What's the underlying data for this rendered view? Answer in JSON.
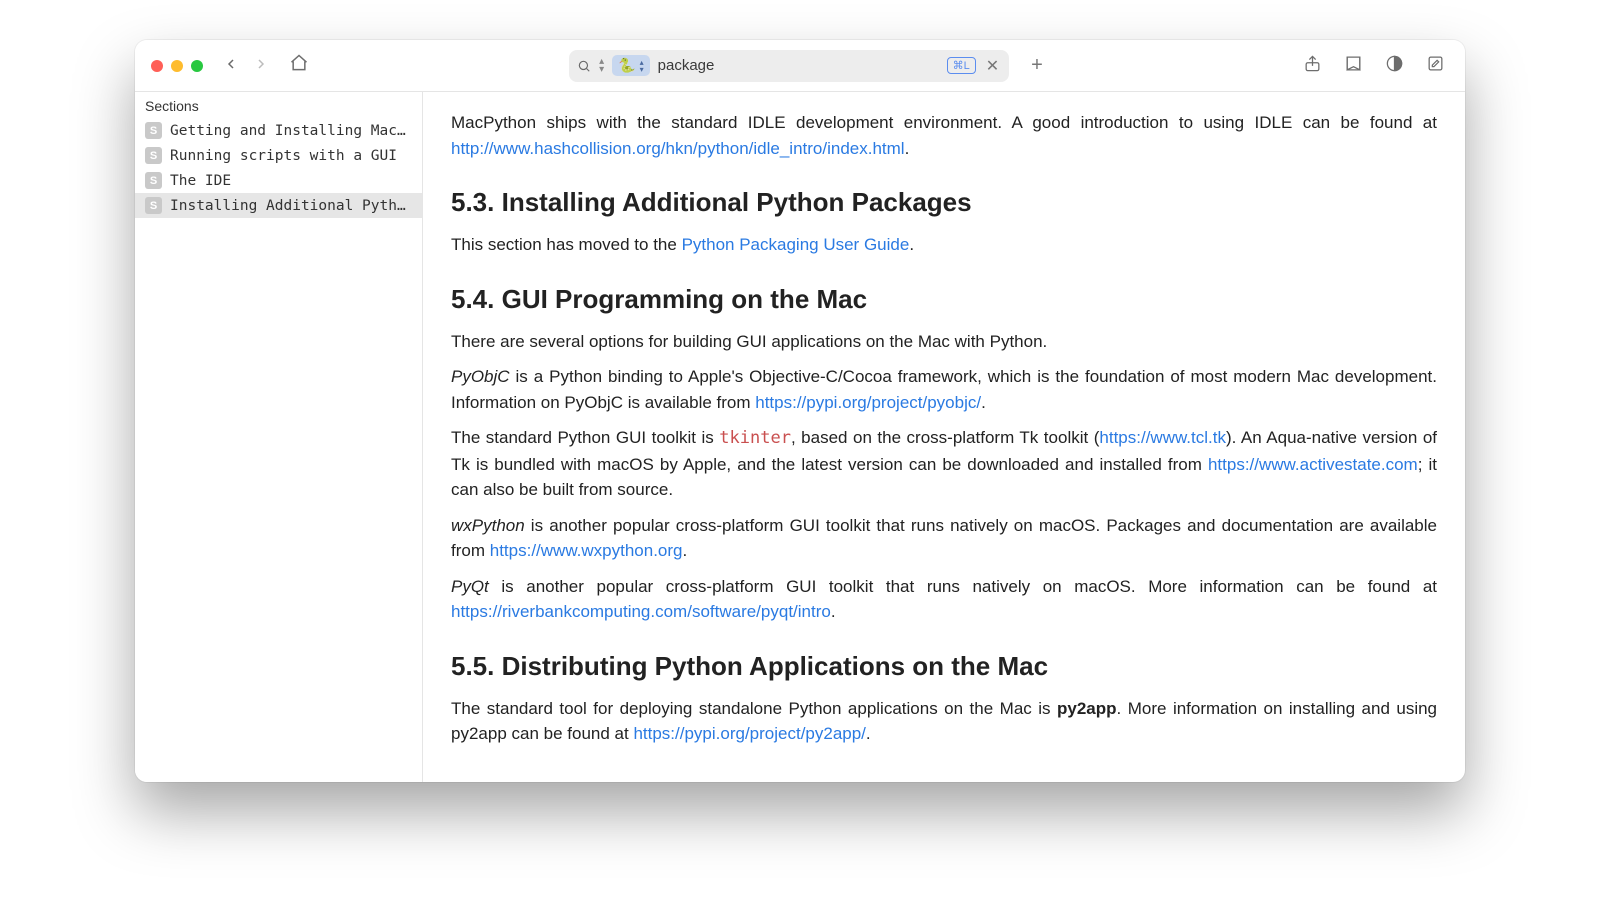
{
  "toolbar": {
    "address_value": "package",
    "shortcut_badge": "⌘L"
  },
  "sidebar": {
    "header": "Sections",
    "items": [
      {
        "badge": "S",
        "label": "Getting and Installing Mac…"
      },
      {
        "badge": "S",
        "label": "Running scripts with a GUI"
      },
      {
        "badge": "S",
        "label": "The IDE"
      },
      {
        "badge": "S",
        "label": "Installing Additional Pyth…"
      }
    ],
    "selected_index": 3
  },
  "doc": {
    "intro_text_a": "MacPython ships with the standard IDLE development environment. A good introduction to using IDLE can be found at ",
    "intro_link": "http://www.hashcollision.org/hkn/python/idle_intro/index.html",
    "intro_text_b": ".",
    "h53": "5.3. Installing Additional Python Packages",
    "p53a": "This section has moved to the ",
    "p53link": "Python Packaging User Guide",
    "p53b": ".",
    "h54": "5.4. GUI Programming on the Mac",
    "p54a": "There are several options for building GUI applications on the Mac with Python.",
    "pyobjc_em": "PyObjC",
    "pyobjc_text": " is a Python binding to Apple's Objective-C/Cocoa framework, which is the foundation of most modern Mac develop­ment. Information on PyObjC is available from ",
    "pyobjc_link": "https://pypi.org/project/pyobjc/",
    "pyobjc_end": ".",
    "tk_a": "The standard Python GUI toolkit is ",
    "tk_code": "tkinter",
    "tk_b": ", based on the cross-platform Tk toolkit (",
    "tk_link1": "https://www.tcl.tk",
    "tk_c": "). An Aqua-native ver­sion of Tk is bundled with macOS by Apple, and the latest version can be downloaded and installed from ",
    "tk_link2": "https://www.actives­tate.com",
    "tk_d": "; it can also be built from source.",
    "wx_em": "wxPython",
    "wx_text": " is another popular cross-platform GUI toolkit that runs natively on macOS. Packages and documentation are avail­able from ",
    "wx_link": "https://www.wxpython.org",
    "wx_end": ".",
    "pyqt_em": "PyQt",
    "pyqt_text": " is another popular cross-platform GUI toolkit that runs natively on macOS. More information can be found at ",
    "pyqt_link": "https://riverbankcomputing.com/software/pyqt/intro",
    "pyqt_end": ".",
    "h55": "5.5. Distributing Python Applications on the Mac",
    "p55a": "The standard tool for deploying standalone Python applications on the Mac is ",
    "p55strong": "py2app",
    "p55b": ". More information on installing and us­ing py2app can be found at ",
    "p55link": "https://pypi.org/project/py2app/",
    "p55c": "."
  }
}
